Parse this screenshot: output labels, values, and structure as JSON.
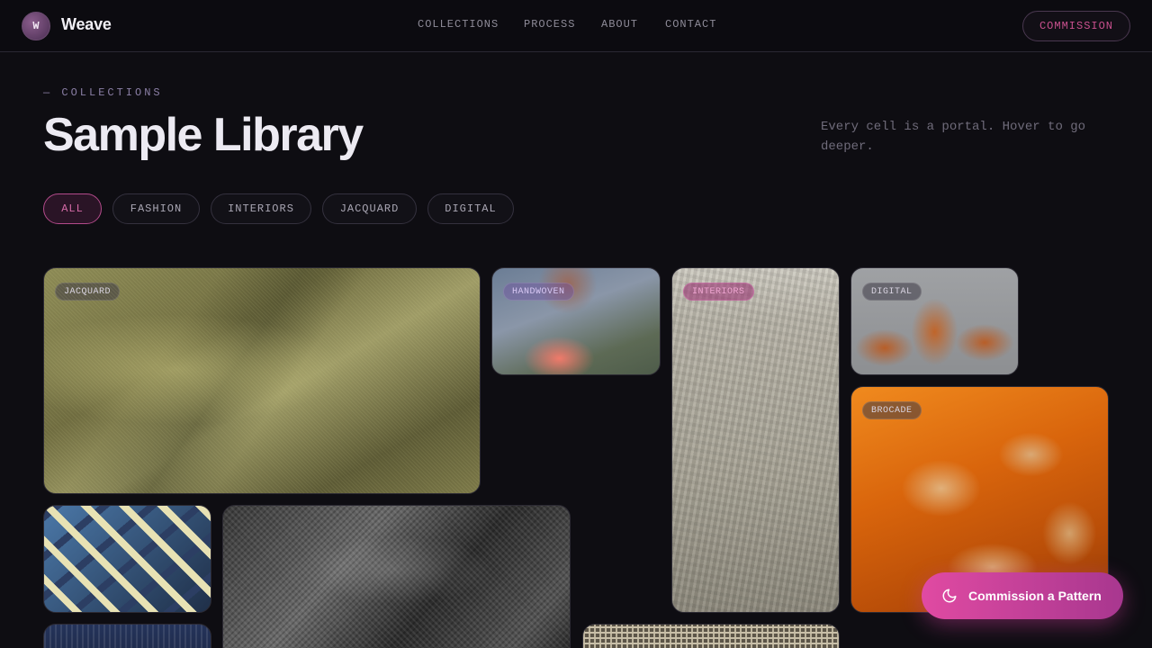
{
  "brand": {
    "mark": "W",
    "name": "Weave"
  },
  "nav": {
    "items": [
      "COLLECTIONS",
      "PROCESS",
      "ABOUT",
      "CONTACT"
    ]
  },
  "header_cta": "COMMISSION",
  "page": {
    "eyebrow": "— COLLECTIONS",
    "title": "Sample Library",
    "tagline": "Every cell is a portal. Hover to go deeper."
  },
  "filters": {
    "items": [
      "ALL",
      "FASHION",
      "INTERIORS",
      "JACQUARD",
      "DIGITAL"
    ],
    "selected": "ALL"
  },
  "tiles": {
    "jacquard": "JACQUARD",
    "handwoven": "HANDWOVEN",
    "interiors": "INTERIORS",
    "digital": "DIGITAL",
    "brocade": "BROCADE"
  },
  "fab": {
    "label": "Commission a Pattern",
    "icon": "moon-icon"
  },
  "colors": {
    "accent": "#d946a0",
    "background": "#0e0d12"
  }
}
